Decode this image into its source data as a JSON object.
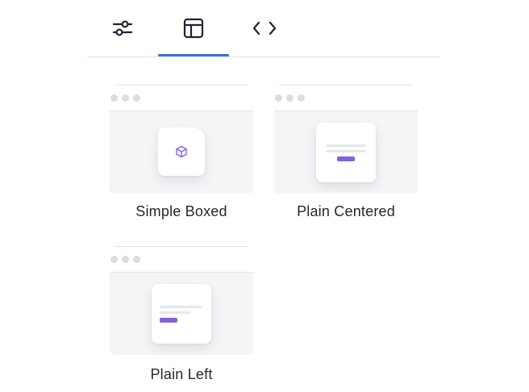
{
  "tabs": [
    {
      "icon": "sliders-icon",
      "active": false
    },
    {
      "icon": "layout-icon",
      "active": true
    },
    {
      "icon": "code-icon",
      "active": false
    }
  ],
  "templates": [
    {
      "label": "Simple Boxed",
      "icon": "cube-icon"
    },
    {
      "label": "Plain Centered"
    },
    {
      "label": "Plain Left"
    }
  ],
  "colors": {
    "accent": "#3b6ede",
    "button": "#8161dd",
    "icon": "#1f2430",
    "cube": "#8a63e0",
    "canvas": "#f4f5f7",
    "divider": "#e3e4e8"
  }
}
